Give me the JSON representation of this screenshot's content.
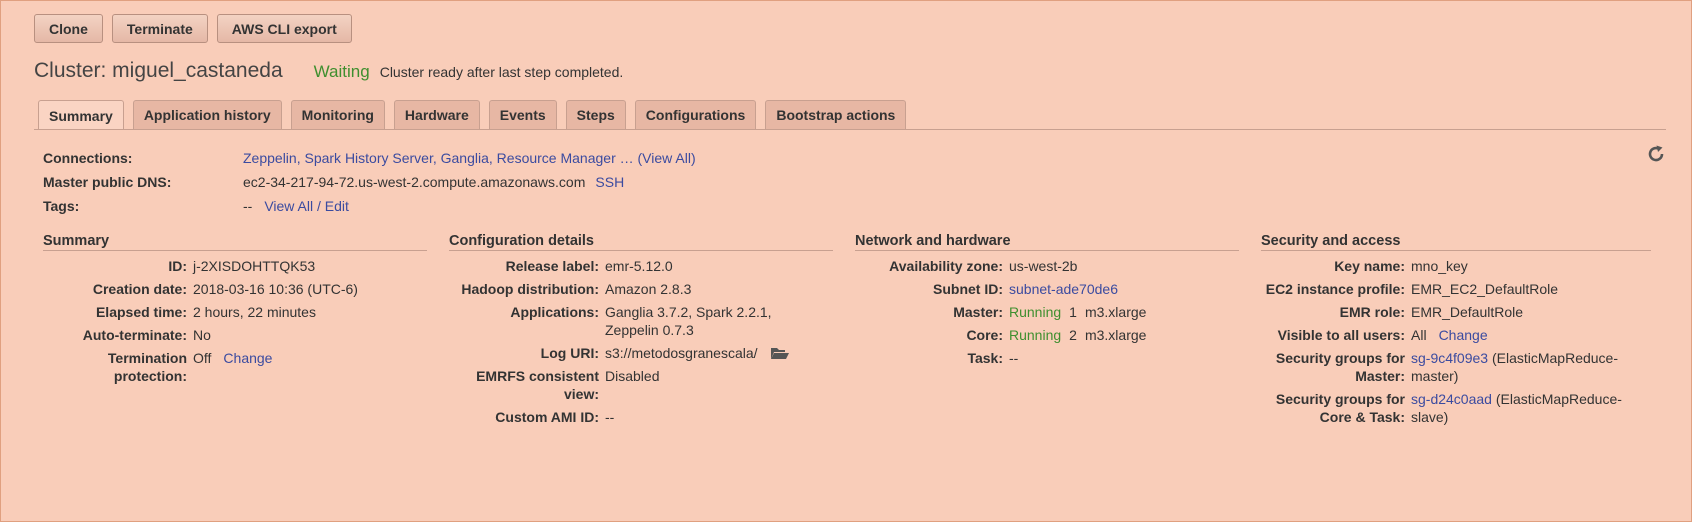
{
  "toolbar": {
    "clone": "Clone",
    "terminate": "Terminate",
    "cli_export": "AWS CLI export"
  },
  "header": {
    "title": "Cluster: miguel_castaneda",
    "status": "Waiting",
    "status_message": "Cluster ready after last step completed."
  },
  "tabs": [
    "Summary",
    "Application history",
    "Monitoring",
    "Hardware",
    "Events",
    "Steps",
    "Configurations",
    "Bootstrap actions"
  ],
  "info": {
    "connections_label": "Connections:",
    "connections_value": "Zeppelin, Spark History Server, Ganglia, Resource Manager … (View All)",
    "dns_label": "Master public DNS:",
    "dns_value": "ec2-34-217-94-72.us-west-2.compute.amazonaws.com",
    "ssh": "SSH",
    "tags_label": "Tags:",
    "tags_value": "--",
    "tags_link": "View All / Edit"
  },
  "summary": {
    "heading": "Summary",
    "id_label": "ID:",
    "id": "j-2XISDOHTTQK53",
    "creation_label": "Creation date:",
    "creation": "2018-03-16 10:36 (UTC-6)",
    "elapsed_label": "Elapsed time:",
    "elapsed": "2 hours, 22 minutes",
    "autoterm_label": "Auto-terminate:",
    "autoterm": "No",
    "termprot_label": "Termination protection:",
    "termprot": "Off",
    "termprot_link": "Change"
  },
  "config": {
    "heading": "Configuration details",
    "release_label": "Release label:",
    "release": "emr-5.12.0",
    "hadoop_label": "Hadoop distribution:",
    "hadoop": "Amazon 2.8.3",
    "apps_label": "Applications:",
    "apps": "Ganglia 3.7.2, Spark 2.2.1, Zeppelin 0.7.3",
    "log_label": "Log URI:",
    "log": "s3://metodosgranescala/",
    "emrfs_label": "EMRFS consistent view:",
    "emrfs": "Disabled",
    "ami_label": "Custom AMI ID:",
    "ami": "--"
  },
  "network": {
    "heading": "Network and hardware",
    "az_label": "Availability zone:",
    "az": "us-west-2b",
    "subnet_label": "Subnet ID:",
    "subnet": "subnet-ade70de6",
    "master_label": "Master:",
    "master_status": "Running",
    "master_count": "1",
    "master_type": "m3.xlarge",
    "core_label": "Core:",
    "core_status": "Running",
    "core_count": "2",
    "core_type": "m3.xlarge",
    "task_label": "Task:",
    "task": "--"
  },
  "security": {
    "heading": "Security and access",
    "key_label": "Key name:",
    "key": "mno_key",
    "profile_label": "EC2 instance profile:",
    "profile": "EMR_EC2_DefaultRole",
    "role_label": "EMR role:",
    "role": "EMR_DefaultRole",
    "visible_label": "Visible to all users:",
    "visible": "All",
    "visible_link": "Change",
    "sg_master_label": "Security groups for Master:",
    "sg_master": "sg-9c4f09e3",
    "sg_master_desc": "(ElasticMapReduce-master)",
    "sg_core_label": "Security groups for Core & Task:",
    "sg_core": "sg-d24c0aad",
    "sg_core_desc": "(ElasticMapReduce-slave)"
  },
  "colors": {
    "background": "#f9cdb9",
    "running": "#3f8f2f",
    "link": "#3b4ba0"
  },
  "icons": {
    "refresh": "refresh-icon",
    "folder": "folder-open-icon"
  }
}
